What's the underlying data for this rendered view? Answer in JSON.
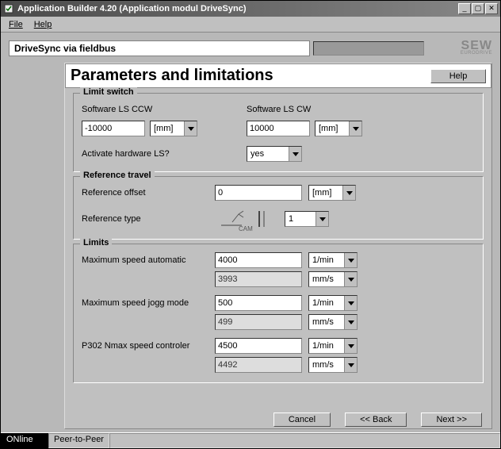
{
  "window": {
    "title": "Application Builder  4.20 (Application modul DriveSync)"
  },
  "menu": {
    "file": "File",
    "help": "Help"
  },
  "header": {
    "fieldbus": "DriveSync via fieldbus",
    "brand": "SEW",
    "brand_sub": "EURODRIVE"
  },
  "page": {
    "title": "Parameters and limitations",
    "help_btn": "Help"
  },
  "limit_switch": {
    "legend": "Limit switch",
    "ls_ccw_label": "Software LS CCW",
    "ls_cw_label": "Software LS CW",
    "ls_ccw_value": "-10000",
    "ls_cw_value": "10000",
    "unit": "[mm]",
    "activate_label": "Activate hardware LS?",
    "activate_value": "yes"
  },
  "reference": {
    "legend": "Reference travel",
    "offset_label": "Reference offset",
    "offset_value": "0",
    "offset_unit": "[mm]",
    "type_label": "Reference type",
    "type_caption": "CAM",
    "type_value": "1"
  },
  "limits": {
    "legend": "Limits",
    "max_auto_label": "Maximum speed automatic",
    "max_auto_value": "4000",
    "max_auto_unit": "1/min",
    "max_auto_conv": "3993",
    "max_auto_conv_unit": "mm/s",
    "max_jog_label": "Maximum speed jogg mode",
    "max_jog_value": "500",
    "max_jog_unit": "1/min",
    "max_jog_conv": "499",
    "max_jog_conv_unit": "mm/s",
    "p302_label": "P302 Nmax speed controler",
    "p302_value": "4500",
    "p302_unit": "1/min",
    "p302_conv": "4492",
    "p302_conv_unit": "mm/s"
  },
  "buttons": {
    "cancel": "Cancel",
    "back": "<< Back",
    "next": "Next >>"
  },
  "status": {
    "online": "ONline",
    "peer": "Peer-to-Peer"
  }
}
